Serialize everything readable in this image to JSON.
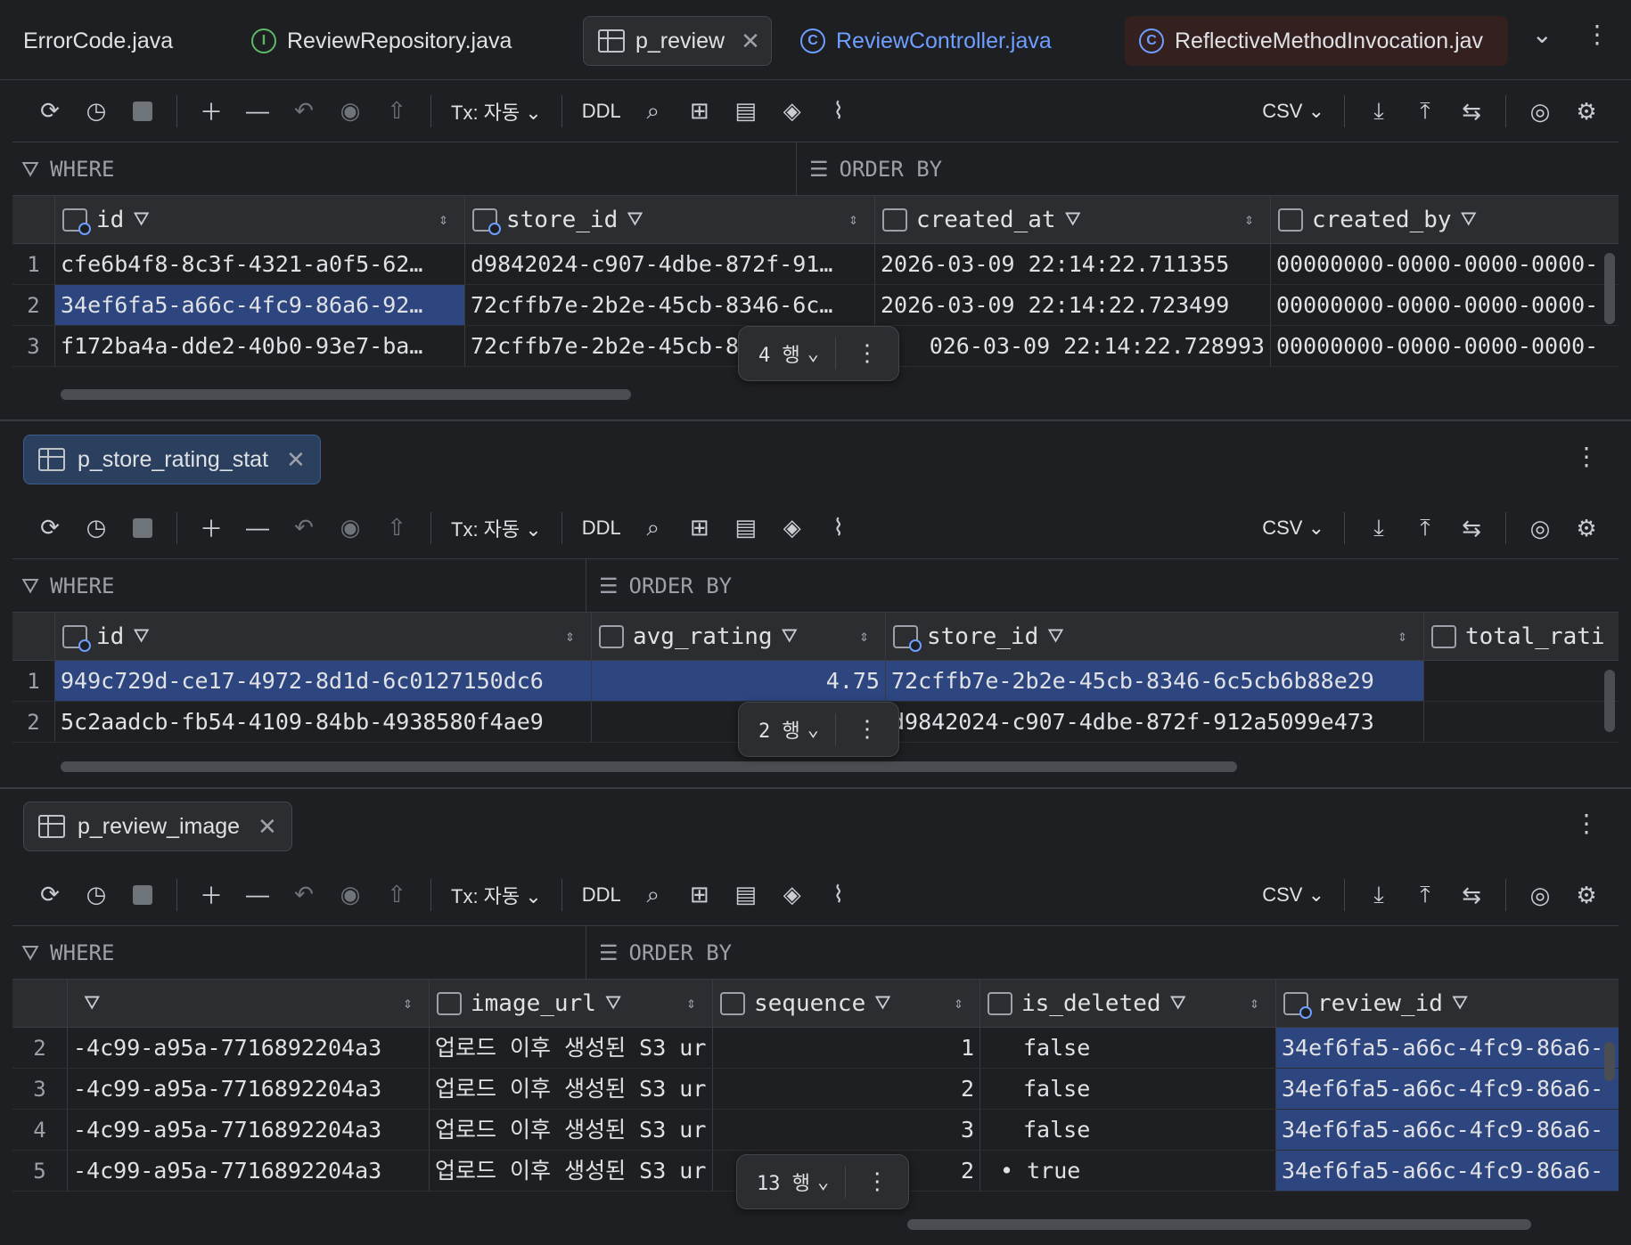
{
  "tabs": [
    {
      "label": "ErrorCode.java"
    },
    {
      "label": "ReviewRepository.java",
      "icon": "I"
    },
    {
      "label": "p_review"
    },
    {
      "label": "ReviewController.java",
      "icon": "C"
    },
    {
      "label": "ReflectiveMethodInvocation.jav",
      "icon": "C"
    }
  ],
  "toolbar": {
    "tx_label": "Tx: 자동",
    "ddl_label": "DDL",
    "csv_label": "CSV"
  },
  "filter": {
    "where": "WHERE",
    "order_by": "ORDER BY"
  },
  "pane1": {
    "columns": [
      "id",
      "store_id",
      "created_at",
      "created_by"
    ],
    "rows": [
      {
        "n": "1",
        "c": [
          "cfe6b4f8-8c3f-4321-a0f5-62…",
          "d9842024-c907-4dbe-872f-91…",
          "2026-03-09 22:14:22.711355",
          "00000000-0000-0000-0000-"
        ]
      },
      {
        "n": "2",
        "c": [
          "34ef6fa5-a66c-4fc9-86a6-92…",
          "72cffb7e-2b2e-45cb-8346-6c…",
          "2026-03-09 22:14:22.723499",
          "00000000-0000-0000-0000-"
        ]
      },
      {
        "n": "3",
        "c": [
          "f172ba4a-dde2-40b0-93e7-ba…",
          "72cffb7e-2b2e-45cb-8",
          "026-03-09 22:14:22.728993",
          "00000000-0000-0000-0000-"
        ]
      }
    ],
    "row_count": "4 행"
  },
  "pane2": {
    "title": "p_store_rating_stat",
    "columns": [
      "id",
      "avg_rating",
      "store_id",
      "total_rati"
    ],
    "rows": [
      {
        "n": "1",
        "c": [
          "949c729d-ce17-4972-8d1d-6c0127150dc6",
          "4.75",
          "72cffb7e-2b2e-45cb-8346-6c5cb6b88e29",
          ""
        ]
      },
      {
        "n": "2",
        "c": [
          "5c2aadcb-fb54-4109-84bb-4938580f4ae9",
          "",
          "d9842024-c907-4dbe-872f-912a5099e473",
          ""
        ]
      }
    ],
    "row_count": "2 행"
  },
  "pane3": {
    "title": "p_review_image",
    "columns": [
      "",
      "image_url",
      "sequence",
      "is_deleted",
      "review_id"
    ],
    "rows": [
      {
        "n": "2",
        "c": [
          "-4c99-a95a-7716892204a3",
          "업로드 이후 생성된 S3 ur",
          "1",
          "false",
          "34ef6fa5-a66c-4fc9-86a6-"
        ]
      },
      {
        "n": "3",
        "c": [
          "-4c99-a95a-7716892204a3",
          "업로드 이후 생성된 S3 ur",
          "2",
          "false",
          "34ef6fa5-a66c-4fc9-86a6-"
        ]
      },
      {
        "n": "4",
        "c": [
          "-4c99-a95a-7716892204a3",
          "업로드 이후 생성된 S3 ur",
          "3",
          "false",
          "34ef6fa5-a66c-4fc9-86a6-"
        ]
      },
      {
        "n": "5",
        "c": [
          "-4c99-a95a-7716892204a3",
          "업로드 이후 생성된 S3 ur",
          "2",
          "• true",
          "34ef6fa5-a66c-4fc9-86a6-"
        ]
      }
    ],
    "row_count": "13 행"
  }
}
